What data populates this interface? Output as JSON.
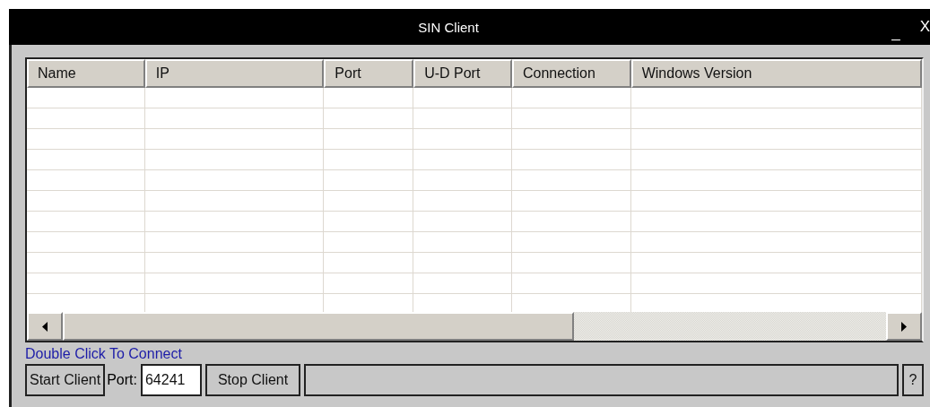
{
  "window": {
    "title": "SIN Client",
    "minimize": "_",
    "close": "X"
  },
  "table": {
    "columns": [
      {
        "label": "Name"
      },
      {
        "label": "IP"
      },
      {
        "label": "Port"
      },
      {
        "label": "U-D Port"
      },
      {
        "label": "Connection"
      },
      {
        "label": "Windows Version"
      }
    ]
  },
  "hint": "Double Click To Connect",
  "toolbar": {
    "start_button": "Start Client",
    "port_label": "Port:",
    "port_value": "64241",
    "stop_button": "Stop Client",
    "help_button": "?"
  }
}
